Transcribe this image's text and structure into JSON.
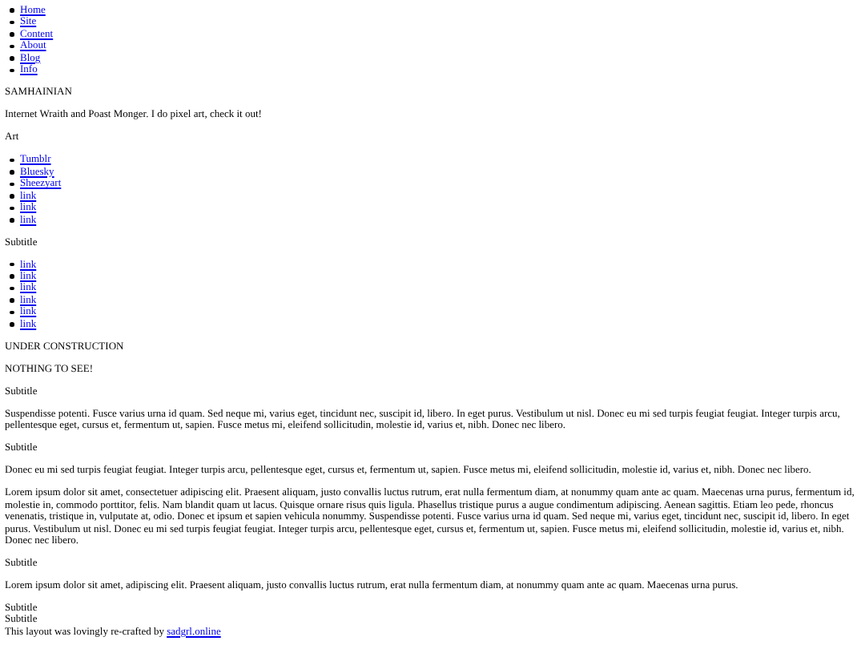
{
  "nav": [
    {
      "label": "Home"
    },
    {
      "label": "Site"
    },
    {
      "label": "Content"
    },
    {
      "label": "About"
    },
    {
      "label": "Blog"
    },
    {
      "label": "Info"
    }
  ],
  "blocks": [
    {
      "kind": "text",
      "text": "SAMHAINIAN"
    },
    {
      "kind": "text",
      "text": "Internet Wraith and Poast Monger. I do pixel art, check it out!"
    },
    {
      "kind": "text",
      "text": "Art"
    },
    {
      "kind": "links",
      "items": [
        "Tumblr",
        "Bluesky",
        "Sheezyart",
        "link",
        "link",
        "link"
      ]
    },
    {
      "kind": "text",
      "text": "Subtitle"
    },
    {
      "kind": "links",
      "items": [
        "link",
        "link",
        "link",
        "link",
        "link",
        "link"
      ]
    },
    {
      "kind": "text",
      "text": "UNDER CONSTRUCTION"
    },
    {
      "kind": "text",
      "text": "NOTHING TO SEE!"
    },
    {
      "kind": "text",
      "text": "Subtitle"
    },
    {
      "kind": "text",
      "text": "Suspendisse potenti. Fusce varius urna id quam. Sed neque mi, varius eget, tincidunt nec, suscipit id, libero. In eget purus. Vestibulum ut nisl. Donec eu mi sed turpis feugiat feugiat. Integer turpis arcu, pellentesque eget, cursus et, fermentum ut, sapien. Fusce metus mi, eleifend sollicitudin, molestie id, varius et, nibh. Donec nec libero."
    },
    {
      "kind": "text",
      "text": "Subtitle"
    },
    {
      "kind": "text",
      "text": "Donec eu mi sed turpis feugiat feugiat. Integer turpis arcu, pellentesque eget, cursus et, fermentum ut, sapien. Fusce metus mi, eleifend sollicitudin, molestie id, varius et, nibh. Donec nec libero."
    },
    {
      "kind": "text",
      "text": "Lorem ipsum dolor sit amet, consectetuer adipiscing elit. Praesent aliquam, justo convallis luctus rutrum, erat nulla fermentum diam, at nonummy quam ante ac quam. Maecenas urna purus, fermentum id, molestie in, commodo porttitor, felis. Nam blandit quam ut lacus. Quisque ornare risus quis ligula. Phasellus tristique purus a augue condimentum adipiscing. Aenean sagittis. Etiam leo pede, rhoncus venenatis, tristique in, vulputate at, odio. Donec et ipsum et sapien vehicula nonummy. Suspendisse potenti. Fusce varius urna id quam. Sed neque mi, varius eget, tincidunt nec, suscipit id, libero. In eget purus. Vestibulum ut nisl. Donec eu mi sed turpis feugiat feugiat. Integer turpis arcu, pellentesque eget, cursus et, fermentum ut, sapien. Fusce metus mi, eleifend sollicitudin, molestie id, varius et, nibh. Donec nec libero."
    },
    {
      "kind": "text",
      "text": "Subtitle"
    },
    {
      "kind": "text",
      "text": "Lorem ipsum dolor sit amet, adipiscing elit. Praesent aliquam, justo convallis luctus rutrum, erat nulla fermentum diam, at nonummy quam ante ac quam. Maecenas urna purus."
    },
    {
      "kind": "line",
      "text": "Subtitle"
    },
    {
      "kind": "line",
      "text": "Subtitle"
    },
    {
      "kind": "credit",
      "text": "This layout was lovingly re-crafted by",
      "link": "sadgrl.online"
    }
  ]
}
